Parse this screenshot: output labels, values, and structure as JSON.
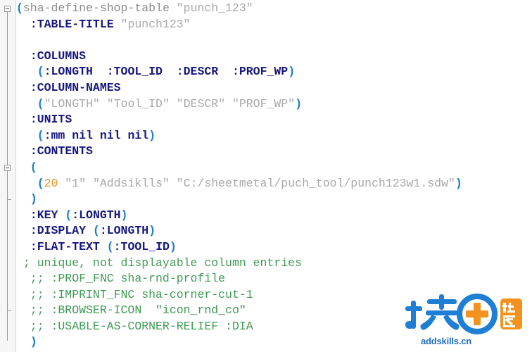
{
  "editor": {
    "language": "lisp",
    "background": "#ffffff",
    "gutter_background": "#f6f6f6",
    "colors": {
      "paren": "#1a7fc1",
      "keyword": "#18177e",
      "string": "#a8a8a8",
      "function": "#8a8a8a",
      "number": "#e8972e",
      "comment": "#3f9a55"
    }
  },
  "gutter": {
    "fold_markers": [
      {
        "type": "fold-box",
        "line": 1,
        "label": "collapse-toplevel-form"
      },
      {
        "type": "fold-box",
        "line": 11,
        "label": "collapse-contents-list"
      },
      {
        "type": "fold-tick",
        "line": 13,
        "label": "fold-region-end"
      },
      {
        "type": "fold-end",
        "line": 20,
        "label": "toplevel-fold-end"
      }
    ]
  },
  "code": {
    "lines": [
      {
        "n": 1,
        "tokens": [
          {
            "t": "(",
            "c": "paren"
          },
          {
            "t": "sha-define-shop-table ",
            "c": "fn"
          },
          {
            "t": "\"punch_123\"",
            "c": "str"
          }
        ]
      },
      {
        "n": 2,
        "tokens": [
          {
            "t": "  ",
            "c": "plain"
          },
          {
            "t": ":TABLE-TITLE",
            "c": "kw"
          },
          {
            "t": " ",
            "c": "plain"
          },
          {
            "t": "\"punch123\"",
            "c": "str"
          }
        ]
      },
      {
        "n": 3,
        "tokens": []
      },
      {
        "n": 4,
        "tokens": [
          {
            "t": "  ",
            "c": "plain"
          },
          {
            "t": ":COLUMNS",
            "c": "kw"
          }
        ]
      },
      {
        "n": 5,
        "tokens": [
          {
            "t": "   ",
            "c": "plain"
          },
          {
            "t": "(",
            "c": "paren"
          },
          {
            "t": ":LONGTH  :TOOL_ID  :DESCR  :PROF_WP",
            "c": "kw"
          },
          {
            "t": ")",
            "c": "paren"
          }
        ]
      },
      {
        "n": 6,
        "tokens": [
          {
            "t": "  ",
            "c": "plain"
          },
          {
            "t": ":COLUMN-NAMES",
            "c": "kw"
          }
        ]
      },
      {
        "n": 7,
        "tokens": [
          {
            "t": "   ",
            "c": "plain"
          },
          {
            "t": "(",
            "c": "paren"
          },
          {
            "t": "\"LONGTH\" \"Tool_ID\" \"DESCR\" \"PROF_WP\"",
            "c": "str"
          },
          {
            "t": ")",
            "c": "paren"
          }
        ]
      },
      {
        "n": 8,
        "tokens": [
          {
            "t": "  ",
            "c": "plain"
          },
          {
            "t": ":UNITS",
            "c": "kw"
          }
        ]
      },
      {
        "n": 9,
        "tokens": [
          {
            "t": "   ",
            "c": "plain"
          },
          {
            "t": "(",
            "c": "paren"
          },
          {
            "t": ":mm nil nil nil",
            "c": "kw"
          },
          {
            "t": ")",
            "c": "paren"
          }
        ]
      },
      {
        "n": 10,
        "tokens": [
          {
            "t": "  ",
            "c": "plain"
          },
          {
            "t": ":CONTENTS",
            "c": "kw"
          }
        ]
      },
      {
        "n": 11,
        "tokens": [
          {
            "t": "  ",
            "c": "plain"
          },
          {
            "t": "(",
            "c": "paren"
          }
        ]
      },
      {
        "n": 12,
        "tokens": [
          {
            "t": "   ",
            "c": "plain"
          },
          {
            "t": "(",
            "c": "paren"
          },
          {
            "t": "20",
            "c": "num"
          },
          {
            "t": " ",
            "c": "plain"
          },
          {
            "t": "\"1\" \"Addsiklls\" \"C:/sheetmetal/puch_tool/punch123w1.sdw\"",
            "c": "str"
          },
          {
            "t": ")",
            "c": "paren"
          }
        ]
      },
      {
        "n": 13,
        "tokens": [
          {
            "t": "  ",
            "c": "plain"
          },
          {
            "t": ")",
            "c": "paren"
          }
        ]
      },
      {
        "n": 14,
        "tokens": [
          {
            "t": "  ",
            "c": "plain"
          },
          {
            "t": ":KEY",
            "c": "kw"
          },
          {
            "t": " ",
            "c": "plain"
          },
          {
            "t": "(",
            "c": "paren"
          },
          {
            "t": ":LONGTH",
            "c": "kw"
          },
          {
            "t": ")",
            "c": "paren"
          }
        ]
      },
      {
        "n": 15,
        "tokens": [
          {
            "t": "  ",
            "c": "plain"
          },
          {
            "t": ":DISPLAY",
            "c": "kw"
          },
          {
            "t": " ",
            "c": "plain"
          },
          {
            "t": "(",
            "c": "paren"
          },
          {
            "t": ":LONGTH",
            "c": "kw"
          },
          {
            "t": ")",
            "c": "paren"
          }
        ]
      },
      {
        "n": 16,
        "tokens": [
          {
            "t": "  ",
            "c": "plain"
          },
          {
            "t": ":FLAT-TEXT",
            "c": "kw"
          },
          {
            "t": " ",
            "c": "plain"
          },
          {
            "t": "(",
            "c": "paren"
          },
          {
            "t": ":TOOL_ID",
            "c": "kw"
          },
          {
            "t": ")",
            "c": "paren"
          }
        ]
      },
      {
        "n": 17,
        "tokens": [
          {
            "t": " ; unique, not displayable column entries",
            "c": "comment"
          }
        ]
      },
      {
        "n": 18,
        "tokens": [
          {
            "t": "  ;; :PROF_FNC sha-rnd-profile",
            "c": "comment"
          }
        ]
      },
      {
        "n": 19,
        "tokens": [
          {
            "t": "  ;; :IMPRINT_FNC sha-corner-cut-1",
            "c": "comment"
          }
        ]
      },
      {
        "n": 20,
        "tokens": [
          {
            "t": "  ;; :BROWSER-ICON  \"icon_rnd_co\"",
            "c": "comment"
          }
        ]
      },
      {
        "n": 21,
        "tokens": [
          {
            "t": "  ;; :USABLE-AS-CORNER-RELIEF :DIA",
            "c": "comment"
          }
        ]
      },
      {
        "n": 22,
        "tokens": [
          {
            "t": "  ",
            "c": "plain"
          },
          {
            "t": ")",
            "c": "paren"
          }
        ]
      }
    ]
  },
  "watermark": {
    "logo_text": "技+",
    "badge_text": "社区",
    "url": "addskills.cn",
    "blue": "#1f7fd4",
    "orange": "#f3921e"
  }
}
